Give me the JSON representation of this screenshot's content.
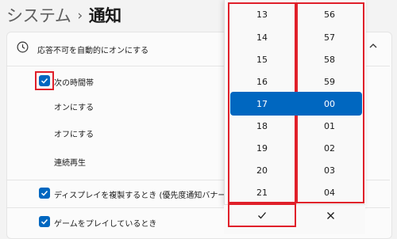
{
  "breadcrumb": {
    "parent": "システム",
    "separator": "›",
    "current": "通知"
  },
  "setting": {
    "title": "応答不可を自動的にオンにする"
  },
  "options": {
    "time_range_label": "次の時間帯",
    "on_label": "オンにする",
    "off_label": "オフにする",
    "repeat_label": "連続再生",
    "display_duplicate_label": "ディスプレイを複製するとき (優先度通知バナーも非表示)",
    "game_label": "ゲームをプレイしているとき"
  },
  "time_picker": {
    "hours": [
      "13",
      "14",
      "15",
      "16",
      "17",
      "18",
      "19",
      "20",
      "21"
    ],
    "minutes": [
      "56",
      "57",
      "58",
      "59",
      "00",
      "01",
      "02",
      "03",
      "04"
    ],
    "selected_hour": "17",
    "selected_minute": "00",
    "confirm_icon": "check-icon",
    "cancel_icon": "close-icon"
  },
  "colors": {
    "accent": "#0067c0",
    "highlight_border": "#e0202a"
  }
}
